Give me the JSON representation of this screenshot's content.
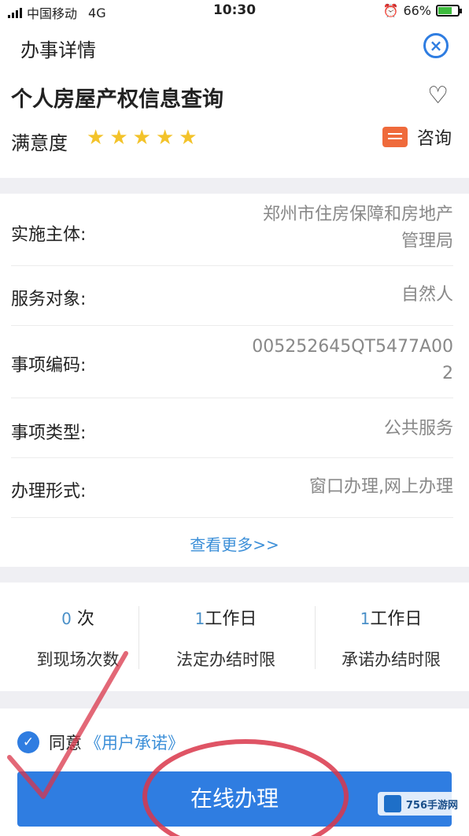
{
  "status_bar": {
    "carrier": "中国移动",
    "network": "4G",
    "time": "10:30",
    "battery": "66%"
  },
  "nav": {
    "title": "办事详情"
  },
  "service": {
    "name": "个人房屋产权信息查询",
    "satisfaction_label": "满意度",
    "stars": 5,
    "consult_label": "咨询"
  },
  "info_rows": [
    {
      "label": "实施主体:",
      "value_line1": "郑州市住房保障和房地产",
      "value_line2": "管理局"
    },
    {
      "label": "服务对象:",
      "value_line1": "自然人"
    },
    {
      "label": "事项编码:",
      "value_line1": "005252645QT5477A00",
      "value_line2": "2"
    },
    {
      "label": "事项类型:",
      "value_line1": "公共服务"
    },
    {
      "label": "办理形式:",
      "value_line1": "窗口办理,网上办理"
    }
  ],
  "more_link": "查看更多>>",
  "stats": [
    {
      "num": "0",
      "unit": "次",
      "caption": "到现场次数"
    },
    {
      "num": "1",
      "unit": "工作日",
      "caption": "法定办结时限"
    },
    {
      "num": "1",
      "unit": "工作日",
      "caption": "承诺办结时限"
    }
  ],
  "agree": {
    "prefix": "同意",
    "link": "《用户承诺》"
  },
  "submit_label": "在线办理",
  "watermark": "756手游网",
  "colors": {
    "accent": "#2f7de1",
    "link": "#3c8fd8",
    "star": "#f3c32a",
    "consult_icon": "#ef6a3b",
    "annotation": "#d9364a"
  }
}
